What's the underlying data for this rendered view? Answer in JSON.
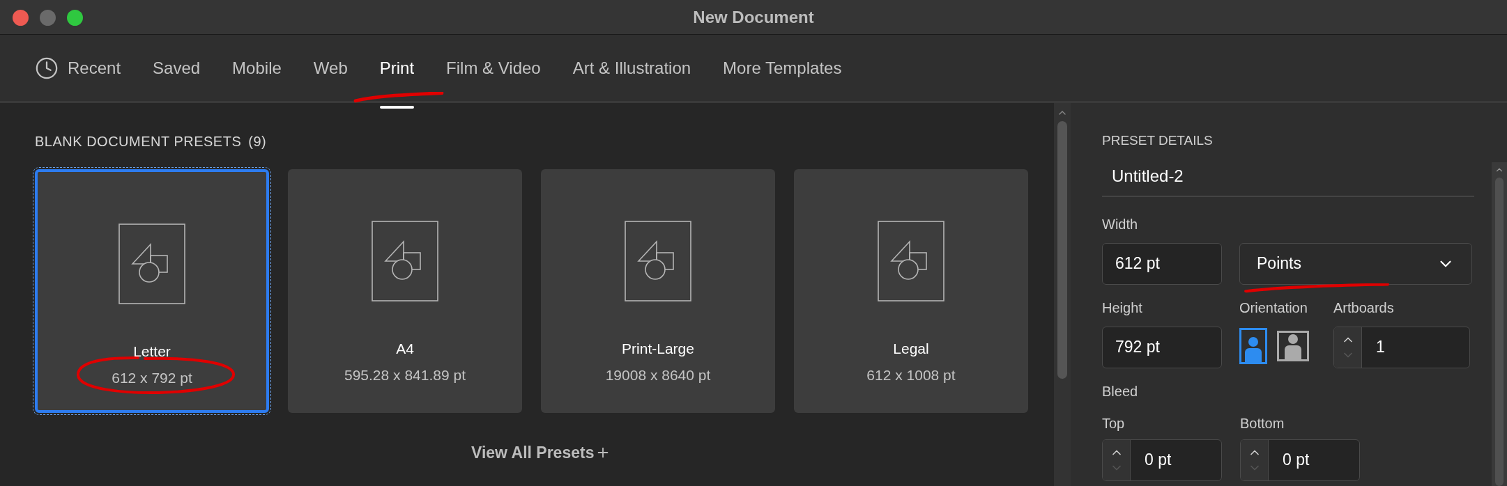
{
  "window": {
    "title": "New Document"
  },
  "tabs": [
    {
      "label": "Recent",
      "kind": "recent",
      "selected": false
    },
    {
      "label": "Saved",
      "kind": "category",
      "selected": false
    },
    {
      "label": "Mobile",
      "kind": "category",
      "selected": false
    },
    {
      "label": "Web",
      "kind": "category",
      "selected": false
    },
    {
      "label": "Print",
      "kind": "category",
      "selected": true
    },
    {
      "label": "Film & Video",
      "kind": "category",
      "selected": false
    },
    {
      "label": "Art & Illustration",
      "kind": "category",
      "selected": false
    },
    {
      "label": "More Templates",
      "kind": "category",
      "selected": false
    }
  ],
  "presets": {
    "heading": "BLANK DOCUMENT PRESETS",
    "count": "(9)",
    "items": [
      {
        "name": "Letter",
        "size": "612 x 792 pt",
        "selected": true
      },
      {
        "name": "A4",
        "size": "595.28 x 841.89 pt",
        "selected": false
      },
      {
        "name": "Print-Large",
        "size": "19008 x 8640 pt",
        "selected": false
      },
      {
        "name": "Legal",
        "size": "612 x 1008 pt",
        "selected": false
      }
    ],
    "view_all": "View All Presets"
  },
  "details": {
    "heading": "PRESET DETAILS",
    "name": "Untitled-2",
    "width": {
      "label": "Width",
      "value": "612 pt"
    },
    "units": {
      "value": "Points"
    },
    "height": {
      "label": "Height",
      "value": "792 pt"
    },
    "orientation": {
      "label": "Orientation",
      "options": [
        {
          "kind": "portrait",
          "selected": true
        },
        {
          "kind": "landscape",
          "selected": false
        }
      ]
    },
    "artboards": {
      "label": "Artboards",
      "value": "1"
    },
    "bleed": {
      "label": "Bleed",
      "fields": [
        {
          "label": "Top",
          "value": "0 pt"
        },
        {
          "label": "Bottom",
          "value": "0 pt"
        }
      ]
    }
  }
}
